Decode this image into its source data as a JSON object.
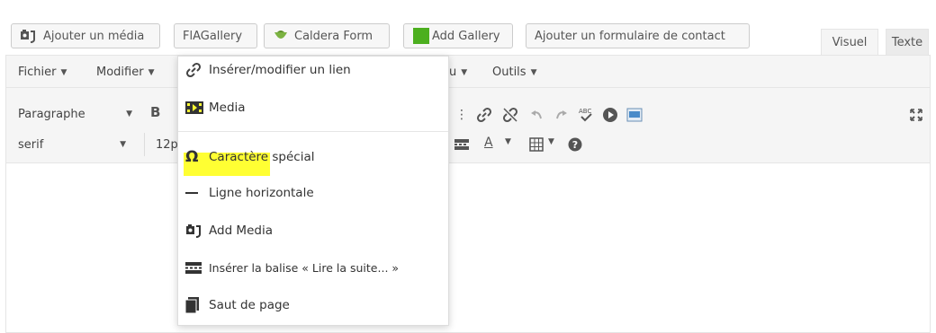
{
  "media_buttons": [
    {
      "label": "Ajouter un média",
      "icon": "add-media-icon"
    },
    {
      "label": "FlAGallery",
      "icon": ""
    },
    {
      "label": "Caldera Form",
      "icon": "caldera-icon"
    },
    {
      "label": "Add Gallery",
      "icon": "green-square-icon"
    },
    {
      "label": "Ajouter un formulaire de contact",
      "icon": ""
    }
  ],
  "tabs": {
    "visuel": "Visuel",
    "texte": "Texte"
  },
  "menubar": {
    "fichier": "Fichier",
    "modifier": "Modifier",
    "insert_partial": "u",
    "outils": "Outils"
  },
  "toolbar": {
    "format_select": "Paragraphe",
    "bold": "B",
    "font_select": "serif",
    "size_select": "12p",
    "text_color": "A"
  },
  "dropdown": {
    "items": [
      {
        "label": "Insérer/modifier un lien",
        "icon": "link-icon"
      },
      {
        "label": "Media",
        "icon": "media-icon"
      },
      {
        "label": "Caractère spécial",
        "icon": "omega-icon"
      },
      {
        "label": "Ligne horizontale",
        "icon": "hr-icon"
      },
      {
        "label": "Add Media",
        "icon": "add-media-icon"
      },
      {
        "label": "Insérer la balise « Lire la suite... »",
        "icon": "read-more-icon"
      },
      {
        "label": "Saut de page",
        "icon": "page-break-icon"
      }
    ],
    "highlight_color": "#ffff33"
  }
}
